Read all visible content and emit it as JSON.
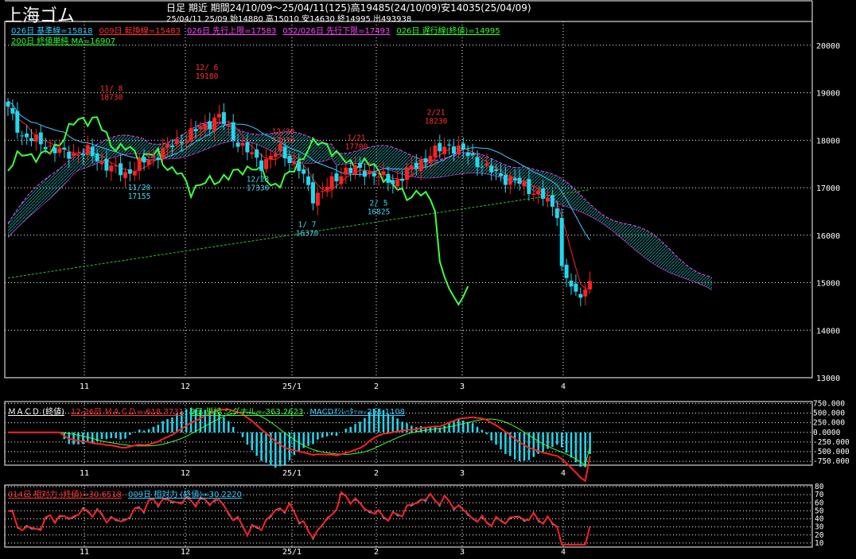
{
  "header": {
    "title": "上海ゴム",
    "line1": "日足 期近  期間24/10/09～25/04/11(125)高19485(24/10/09)安14035(25/04/09)",
    "line2": "25/04/11 25/09 始14880 高15010 安14630 終14995 出493938"
  },
  "legends": {
    "main1": [
      {
        "text": "026日 基準線=15818",
        "color": "#33ccff"
      },
      {
        "text": "009日 転換線=15483",
        "color": "#ff3333"
      },
      {
        "text": "026日 先行上限=17583",
        "color": "#ff44ff"
      },
      {
        "text": "052/026日 先行下限=17493",
        "color": "#ff44ff"
      },
      {
        "text": "026日 遅行線(終値)=14995",
        "color": "#33ff33"
      }
    ],
    "main2": [
      {
        "text": "200日 終値単純 MA=16907",
        "color": "#33ff33"
      }
    ],
    "macd": [
      {
        "text": "ＭＡＣＤ (終値)",
        "color": "#ffffff"
      },
      {
        "text": "12-26日 ＭＡＣＤ=-618.3731",
        "color": "#ff3333"
      },
      {
        "text": "9日 単純 シグナル=-363.2623",
        "color": "#33ff33"
      },
      {
        "text": "MACDｵｼﾚｰﾀｰ=-255.1108",
        "color": "#33ccff"
      }
    ],
    "rsi": [
      {
        "text": "014日 相対力 (終値)=30.6518",
        "color": "#ff3333"
      },
      {
        "text": "009日 相対力 (終値)=30.2220",
        "color": "#33ccff"
      }
    ]
  },
  "colors": {
    "up": "#ff2020",
    "down": "#20d8f0",
    "kijun": "#40c8ff",
    "tenkan": "#ff2020",
    "span": "#ff40ff",
    "cloud": "#20e0e0",
    "chikou": "#40ff40",
    "ma": "#30c030",
    "grid": "#ffffff",
    "ann_high": "#ff3333",
    "ann_low": "#40d8f0"
  },
  "chart_data": [
    {
      "type": "candlestick",
      "title": "上海ゴム 日足 期近",
      "x_labels": [
        "11",
        "12",
        "25/1",
        "2",
        "3",
        "4"
      ],
      "ylim": [
        13000,
        20500
      ],
      "y_ticks": [
        20000,
        19000,
        18000,
        17000,
        16000,
        15000,
        14000,
        13000
      ],
      "annotations": [
        {
          "text": "11/ 8",
          "value": "18730",
          "kind": "high"
        },
        {
          "text": "12/ 6",
          "value": "19180",
          "kind": "high"
        },
        {
          "text": "12/30",
          "value": "17830",
          "kind": "high"
        },
        {
          "text": "1/21",
          "value": "17700",
          "kind": "high"
        },
        {
          "text": "2/21",
          "value": "18230",
          "kind": "high"
        },
        {
          "text": "11/20",
          "value": "17155",
          "kind": "low"
        },
        {
          "text": "12/23",
          "value": "17330",
          "kind": "low"
        },
        {
          "text": "1/ 7",
          "value": "16370",
          "kind": "low"
        },
        {
          "text": "2/ 5",
          "value": "16825",
          "kind": "low"
        }
      ]
    },
    {
      "type": "line",
      "title": "ＭＡＣＤ (終値)",
      "ylim": [
        -850,
        800
      ],
      "y_ticks": [
        750,
        500,
        250,
        0,
        -250,
        -500,
        -750
      ],
      "y_tick_labels": [
        "750.000",
        "500.000",
        "250.000",
        "0.0000",
        "-250.000",
        "-500.000",
        "-750.000"
      ],
      "series": [
        {
          "name": "12-26日 ＭＡＣＤ",
          "last": -618.3731
        },
        {
          "name": "9日 単純 シグナル",
          "last": -363.2623
        },
        {
          "name": "MACDｵｼﾚｰﾀｰ",
          "last": -255.1108
        }
      ]
    },
    {
      "type": "line",
      "title": "相対力",
      "ylim": [
        5,
        82
      ],
      "y_ticks": [
        80,
        70,
        60,
        50,
        40,
        30,
        20,
        10
      ],
      "series": [
        {
          "name": "014日 相対力 (終値)",
          "last": 30.6518
        },
        {
          "name": "009日 相対力 (終値)",
          "last": 30.222
        }
      ]
    }
  ]
}
